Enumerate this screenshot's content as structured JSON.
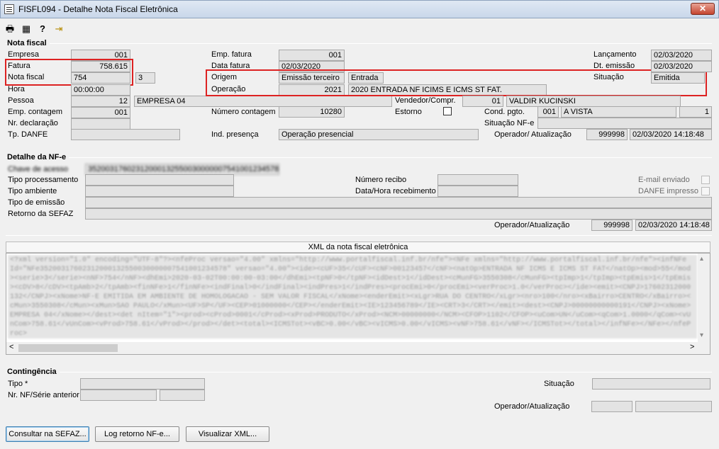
{
  "window": {
    "title": "FISFL094 - Detalhe Nota Fiscal Eletrônica",
    "close": "✕"
  },
  "toolbar": {
    "print_icon": "🖶",
    "calc_icon": "▦",
    "help_icon": "?",
    "exit_icon": "⇥"
  },
  "nota_fiscal": {
    "group_title": "Nota fiscal",
    "empresa_label": "Empresa",
    "empresa_value": "001",
    "fatura_label": "Fatura",
    "fatura_value": "758.615",
    "nota_label": "Nota fiscal",
    "nota_value": "754",
    "serie_value": "3",
    "hora_label": "Hora",
    "hora_value": "00:00:00",
    "pessoa_label": "Pessoa",
    "pessoa_code": "12",
    "pessoa_name": "EMPRESA 04",
    "emp_contagem_label": "Emp. contagem",
    "emp_contagem_value": "001",
    "nr_declaracao_label": "Nr. declaração",
    "tp_danfe_label": "Tp. DANFE",
    "emp_fatura_label": "Emp. fatura",
    "emp_fatura_value": "001",
    "data_fatura_label": "Data fatura",
    "data_fatura_value": "02/03/2020",
    "origem_label": "Origem",
    "origem_value": "Emissão terceiro",
    "origem_tipo": "Entrada",
    "operacao_label": "Operação",
    "operacao_code": "2021",
    "operacao_desc": "2020 ENTRADA NF ICIMS E ICMS ST FAT.",
    "numero_contagem_label": "Número contagem",
    "numero_contagem_value": "10280",
    "ind_presenca_label": "Ind. presença",
    "ind_presenca_value": "Operação presencial",
    "vendedor_label": "Vendedor/Compr.",
    "vendedor_code": "01",
    "vendedor_name": "VALDIR KUCINSKI",
    "estorno_label": "Estorno",
    "cond_pgto_label": "Cond. pgto.",
    "cond_pgto_code": "001",
    "cond_pgto_desc": "A VISTA",
    "cond_pgto_n": "1",
    "situacao_nfe_label": "Situação NF-e",
    "lancamento_label": "Lançamento",
    "lancamento_value": "02/03/2020",
    "dt_emissao_label": "Dt. emissão",
    "dt_emissao_value": "02/03/2020",
    "situacao_label": "Situação",
    "situacao_value": "Emitida",
    "operador_label": "Operador/ Atualização",
    "operador_code": "999998",
    "operador_datetime": "02/03/2020 14:18:48"
  },
  "detalhe_nfe": {
    "group_title": "Detalhe da NF-e",
    "chave_label": "Chave de acesso",
    "chave_value": "35200317602312000132550030000007541001234578",
    "tipo_processamento_label": "Tipo processamento",
    "tipo_ambiente_label": "Tipo ambiente",
    "tipo_emissao_label": "Tipo de emissão",
    "retorno_label": "Retorno da SEFAZ",
    "numero_recibo_label": "Número recibo",
    "data_hora_recebimento_label": "Data/Hora recebimento",
    "email_enviado_label": "E-mail enviado",
    "danfe_impresso_label": "DANFE impresso",
    "operador_label": "Operador/Atualização",
    "operador_code": "999998",
    "operador_datetime": "02/03/2020 14:18:48"
  },
  "xml": {
    "header": "XML da nota fiscal eletrônica",
    "content": "<?xml version=\"1.0\" encoding=\"UTF-8\"?><nfeProc versao=\"4.00\" xmlns=\"http://www.portalfiscal.inf.br/nfe\"><NFe xmlns=\"http://www.portalfiscal.inf.br/nfe\"><infNFe Id=\"NFe35200317602312000132550030000007541001234578\" versao=\"4.00\"><ide><cUF>35</cUF><cNF>00123457</cNF><natOp>ENTRADA NF ICMS E ICMS ST FAT</natOp><mod>55</mod><serie>3</serie><nNF>754</nNF><dhEmi>2020-03-02T00:00:00-03:00</dhEmi><tpNF>0</tpNF><idDest>1</idDest><cMunFG>3550308</cMunFG><tpImp>1</tpImp><tpEmis>1</tpEmis><cDV>8</cDV><tpAmb>2</tpAmb><finNFe>1</finNFe><indFinal>0</indFinal><indPres>1</indPres><procEmi>0</procEmi><verProc>1.0</verProc></ide><emit><CNPJ>17602312000132</CNPJ><xNome>NF-E EMITIDA EM AMBIENTE DE HOMOLOGACAO - SEM VALOR FISCAL</xNome><enderEmit><xLgr>RUA DO CENTRO</xLgr><nro>100</nro><xBairro>CENTRO</xBairro><cMun>3550308</cMun><xMun>SAO PAULO</xMun><UF>SP</UF><CEP>01000000</CEP></enderEmit><IE>123456789</IE><CRT>3</CRT></emit><dest><CNPJ>00000000000191</CNPJ><xNome>EMPRESA 04</xNome></dest><det nItem=\"1\"><prod><cProd>0001</cProd><xProd>PRODUTO</xProd><NCM>00000000</NCM><CFOP>1102</CFOP><uCom>UN</uCom><qCom>1.0000</qCom><vUnCom>758.61</vUnCom><vProd>758.61</vProd></prod></det><total><ICMSTot><vBC>0.00</vBC><vICMS>0.00</vICMS><vNF>758.61</vNF></ICMSTot></total></infNFe></NFe></nfeProc>"
  },
  "contingencia": {
    "group_title": "Contingência",
    "tipo_label": "Tipo *",
    "nr_nf_label": "Nr. NF/Série anterior",
    "situacao_label": "Situação",
    "operador_label": "Operador/Atualização"
  },
  "buttons": {
    "consultar": "Consultar na SEFAZ...",
    "log": "Log retorno NF-e...",
    "visualizar": "Visualizar XML..."
  },
  "scroll": {
    "up": "▴",
    "down": "▾",
    "left": "<",
    "right": ">"
  }
}
